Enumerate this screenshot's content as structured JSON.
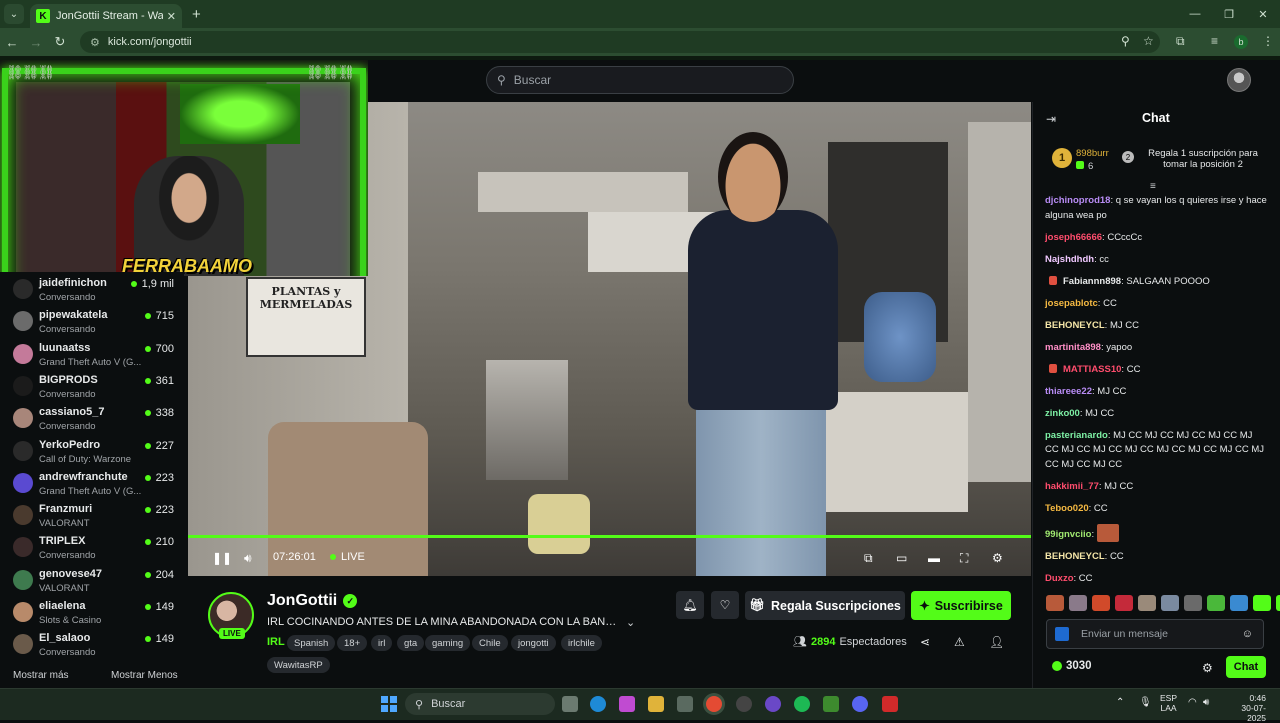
{
  "browser": {
    "tab_title": "JonGottii Stream - Watch L",
    "tab_favicon": "K",
    "url": "kick.com/jongottii",
    "profile_letter": "b"
  },
  "header": {
    "search_placeholder": "Buscar"
  },
  "overlay": {
    "cam_logo": "FERRABAAMO",
    "sign_text": "PLANTAS y MERMELADAS"
  },
  "sidebar": {
    "channels": [
      {
        "name": "jaidefinichon",
        "category": "Conversando",
        "viewers": "1,9 mil"
      },
      {
        "name": "pipewakatela",
        "category": "Conversando",
        "viewers": "715"
      },
      {
        "name": "luunaatss",
        "category": "Grand Theft Auto V (G...",
        "viewers": "700"
      },
      {
        "name": "BIGPRODS",
        "category": "Conversando",
        "viewers": "361"
      },
      {
        "name": "cassiano5_7",
        "category": "Conversando",
        "viewers": "338"
      },
      {
        "name": "YerkoPedro",
        "category": "Call of Duty: Warzone",
        "viewers": "227"
      },
      {
        "name": "andrewfranchute",
        "category": "Grand Theft Auto V (G...",
        "viewers": "223"
      },
      {
        "name": "Franzmuri",
        "category": "VALORANT",
        "viewers": "223"
      },
      {
        "name": "TRIPLEX",
        "category": "Conversando",
        "viewers": "210"
      },
      {
        "name": "genovese47",
        "category": "VALORANT",
        "viewers": "204"
      },
      {
        "name": "eliaelena",
        "category": "Slots & Casino",
        "viewers": "149"
      },
      {
        "name": "El_salaoo",
        "category": "Conversando",
        "viewers": "149"
      }
    ],
    "show_more": "Mostrar más",
    "show_less": "Mostrar Menos"
  },
  "player": {
    "time": "07:26:01",
    "live": "LIVE",
    "progress": 1.0
  },
  "stream": {
    "streamer": "JonGottii",
    "live_badge": "LIVE",
    "title": "IRL COCINANDO ANTES DE LA MINA ABANDONADA CON LA BANDA ...",
    "category": "IRL",
    "tags": [
      "Spanish",
      "18+",
      "irl",
      "gta",
      "gaming",
      "Chile",
      "jongotti",
      "irlchile",
      "WawitasRP"
    ],
    "gift_label": "Regala Suscripciones",
    "subscribe_label": "Suscribirse",
    "viewer_count": "2894",
    "viewer_label": "Espectadores"
  },
  "chat": {
    "title": "Chat",
    "pinned": {
      "rank": "1",
      "user": "898burr",
      "count": "6",
      "position_badge": "2",
      "text": "Regala 1 suscripción para tomar la posición 2"
    },
    "messages": [
      {
        "user": "djchinoprod18",
        "text": "q se vayan los q quieres irse y hace alguna wea po",
        "color": "#b88cf5"
      },
      {
        "user": "joseph66666",
        "text": "CCccCc",
        "color": "#ff4d6d"
      },
      {
        "user": "Najshdhdh",
        "text": "cc",
        "color": "#f0c8ff"
      },
      {
        "user": "Fabiannn898",
        "text": "SALGAAN POOOO",
        "color": "#e7e9ea",
        "badge": "#e05040"
      },
      {
        "user": "josepablotc",
        "text": "CC",
        "color": "#f5b942"
      },
      {
        "user": "BEHONEYCL",
        "text": "MJ CC",
        "color": "#f5e6a8"
      },
      {
        "user": "martinita898",
        "text": "yapoo",
        "color": "#ff8fc7"
      },
      {
        "user": "MATTIASS10",
        "text": "CC",
        "color": "#ff4d6d",
        "badge": "#e05040"
      },
      {
        "user": "thiareee22",
        "text": "MJ CC",
        "color": "#b88cf5"
      },
      {
        "user": "zinko00",
        "text": "MJ CC",
        "color": "#7ef0a5"
      },
      {
        "user": "pasterianardo",
        "text": "MJ CC MJ CC MJ CC MJ CC MJ CC MJ CC MJ CC MJ CC MJ CC MJ CC MJ CC MJ CC MJ CC MJ CC",
        "color": "#7ef0a5"
      },
      {
        "user": "hakkimii_77",
        "text": "MJ CC",
        "color": "#ff4d6d"
      },
      {
        "user": "Teboo020",
        "text": "CC",
        "color": "#f5b942"
      },
      {
        "user": "99ignvciio",
        "text": "",
        "color": "#a0e870",
        "emote": true
      },
      {
        "user": "BEHONEYCL",
        "text": "CC",
        "color": "#f5e6a8"
      },
      {
        "user": "Duxzo",
        "text": "CC",
        "color": "#ff4d6d"
      }
    ],
    "input_placeholder": "Enviar un mensaje",
    "points": "3030",
    "send_label": "Chat"
  },
  "taskbar": {
    "search_placeholder": "Buscar",
    "lang_line1": "ESP",
    "lang_line2": "LAA",
    "time": "0:46",
    "date": "30-07-2025"
  },
  "colors": {
    "accent": "#53fc18",
    "background": "#0b0e0f"
  }
}
